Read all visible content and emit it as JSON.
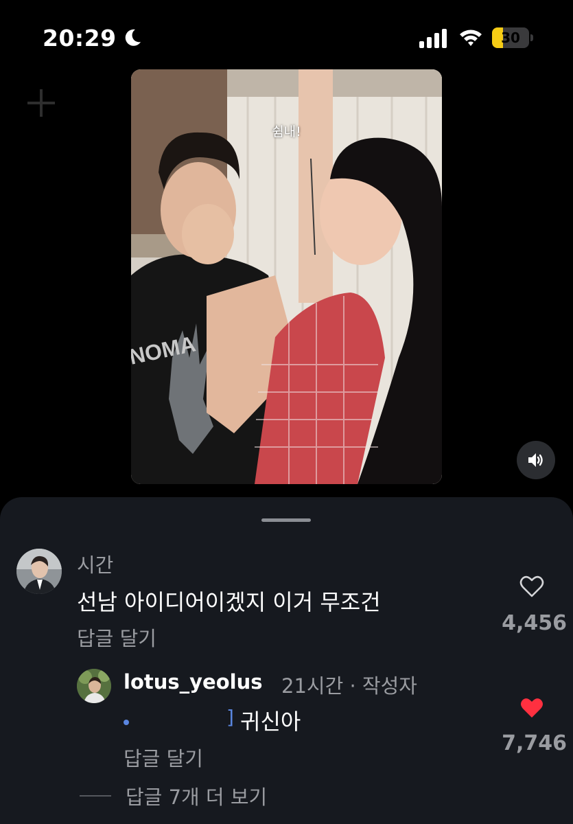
{
  "status_bar": {
    "time": "20:29",
    "battery_level": "30",
    "battery_fraction": 0.3,
    "battery_color": "#f6cc15"
  },
  "video": {
    "caption": "쉼내!"
  },
  "comments": [
    {
      "meta": "시간",
      "text": "선남 아이디어이겠지 이거 무조건",
      "reply_label": "답글 달기",
      "likes": "4,456",
      "liked": false
    },
    {
      "username": "lotus_yeolus",
      "meta": "21시간 · 작성자",
      "text": "귀신아",
      "reply_label": "답글 달기",
      "likes": "7,746",
      "liked": true,
      "like_color": "#ff3040"
    }
  ],
  "more_replies": "답글 7개 더 보기",
  "icons": [
    "moon-icon",
    "signal-icon",
    "wifi-icon",
    "battery-icon",
    "speaker-icon",
    "heart-outline-icon",
    "heart-filled-icon"
  ]
}
